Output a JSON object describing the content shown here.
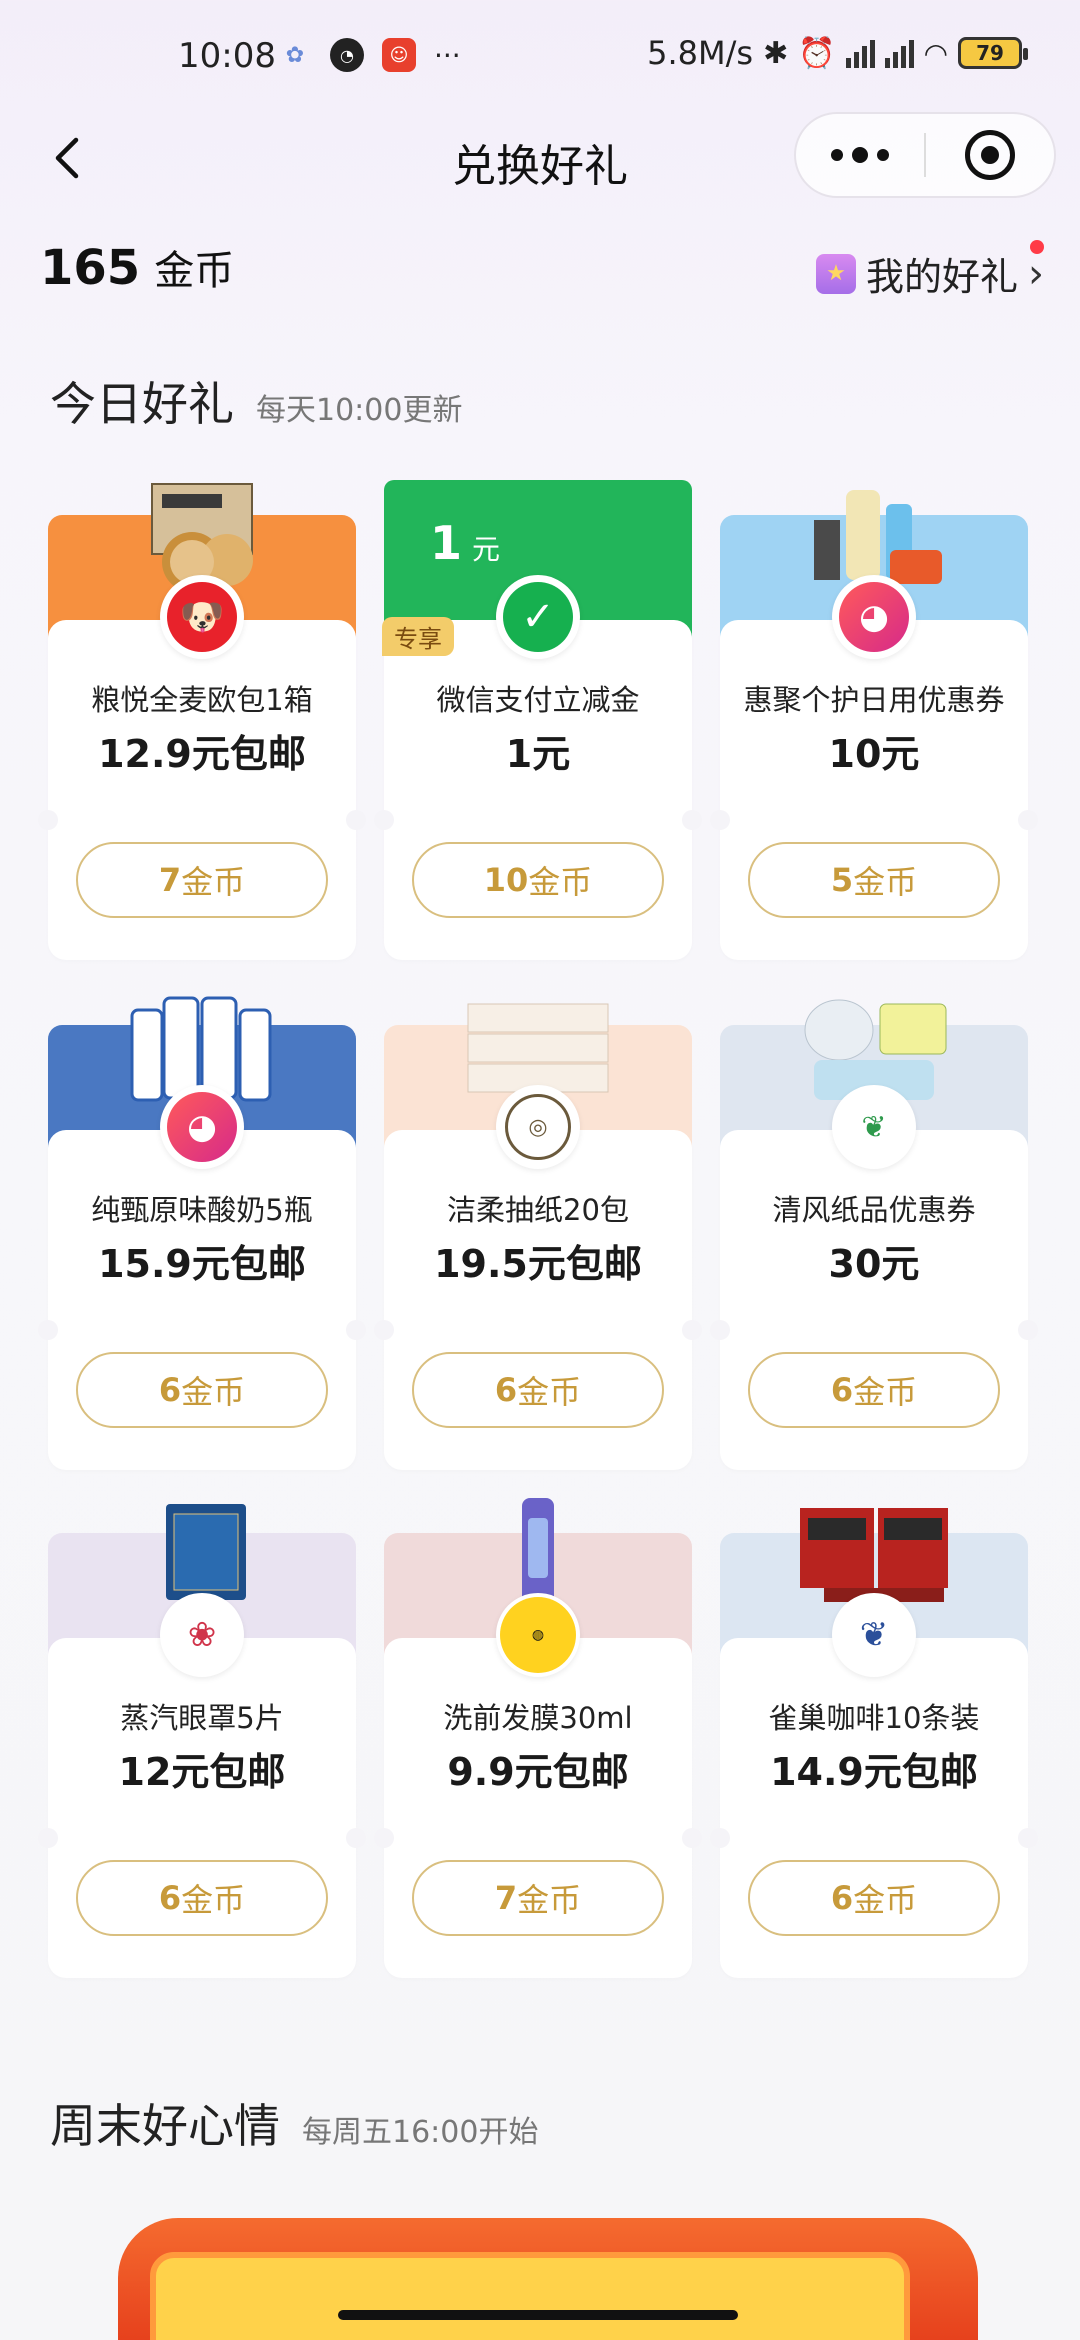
{
  "status_bar": {
    "time": "10:08",
    "net_speed": "5.8M/s",
    "battery": "79",
    "more": "···"
  },
  "nav": {
    "title": "兑换好礼"
  },
  "account": {
    "coins": "165",
    "coin_unit": "金币",
    "my_gifts": "我的好礼",
    "chevron": "›"
  },
  "today": {
    "title": "今日好礼",
    "subtitle": "每天10:00更新"
  },
  "weekend": {
    "title": "周末好心情",
    "subtitle": "每周五16:00开始"
  },
  "colors": {
    "accent_gold": "#c79a3a",
    "button_border": "#d9bf7f"
  },
  "gifts": [
    {
      "name": "粮悦全麦欧包1箱",
      "price": "12.9元包邮",
      "coins": "7",
      "unit": "金币",
      "band_color": "#f6903f",
      "logo": "jd-logo-icon"
    },
    {
      "name": "微信支付立减金",
      "price": "1元",
      "coins": "10",
      "unit": "金币",
      "band_color": "#22b55a",
      "logo": "wechat-pay-icon",
      "tag": "专享",
      "voucher_value": "1",
      "voucher_unit": "元"
    },
    {
      "name": "惠聚个护日用优惠券",
      "price": "10元",
      "coins": "5",
      "unit": "金币",
      "band_color": "#9fd3f3",
      "logo": "huiju-logo-icon"
    },
    {
      "name": "纯甄原味酸奶5瓶",
      "price": "15.9元包邮",
      "coins": "6",
      "unit": "金币",
      "band_color": "#4a78c2",
      "logo": "huiju-logo-icon"
    },
    {
      "name": "洁柔抽纸20包",
      "price": "19.5元包邮",
      "coins": "6",
      "unit": "金币",
      "band_color": "#fbe3d4",
      "logo": "jierou-logo-icon"
    },
    {
      "name": "清风纸品优惠券",
      "price": "30元",
      "coins": "6",
      "unit": "金币",
      "band_color": "#dfe6f0",
      "logo": "qingfeng-logo-icon"
    },
    {
      "name": "蒸汽眼罩5片",
      "price": "12元包邮",
      "coins": "6",
      "unit": "金币",
      "band_color": "#e9e3f1",
      "logo": "yunifang-logo-icon"
    },
    {
      "name": "洗前发膜30ml",
      "price": "9.9元包邮",
      "coins": "7",
      "unit": "金币",
      "band_color": "#f0dada",
      "logo": "colorlomo-logo-icon"
    },
    {
      "name": "雀巢咖啡10条装",
      "price": "14.9元包邮",
      "coins": "6",
      "unit": "金币",
      "band_color": "#dce6f2",
      "logo": "nestle-logo-icon"
    }
  ]
}
